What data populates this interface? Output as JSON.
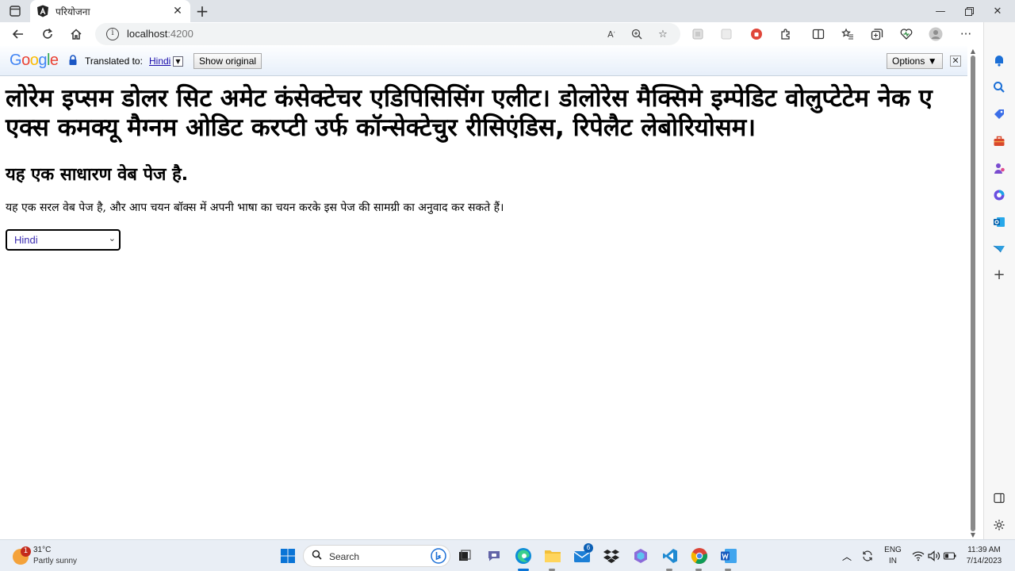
{
  "browser": {
    "tab": {
      "title": "परियोजना"
    },
    "address": {
      "host": "localhost",
      "port": ":4200"
    }
  },
  "translate_bar": {
    "logo": "Google",
    "translated_to_label": "Translated to:",
    "language": "Hindi",
    "show_original_label": "Show original",
    "options_label": "Options ▼"
  },
  "page": {
    "heading": "लोरेम इप्सम डोलर सिट अमेट कंसेक्टेचर एडिपिसिसिंग एलीट। डोलोरेस मैक्सिमे इम्पेडिट वोलुप्टेटेम नेक ए एक्स कमक्यू मैग्नम ओडिट करप्टी उर्फ कॉन्सेक्टेचुर रीसिएंडिस, रिपेलैट लेबोरियोसम।",
    "subheading": "यह एक साधारण वेब पेज है.",
    "paragraph": "यह एक सरल वेब पेज है, और आप चयन बॉक्स में अपनी भाषा का चयन करके इस पेज की सामग्री का अनुवाद कर सकते हैं।",
    "language_select": {
      "selected": "Hindi"
    }
  },
  "taskbar": {
    "weather": {
      "temp": "31°C",
      "condition": "Partly sunny",
      "badge": "1"
    },
    "search_label": "Search",
    "mail_badge": "6",
    "language": {
      "line1": "ENG",
      "line2": "IN"
    },
    "clock": {
      "time": "11:39 AM",
      "date": "7/14/2023"
    }
  },
  "colors": {
    "accent": "#0078d4",
    "link": "#1a0dab",
    "select_text": "#3a2bb0"
  }
}
